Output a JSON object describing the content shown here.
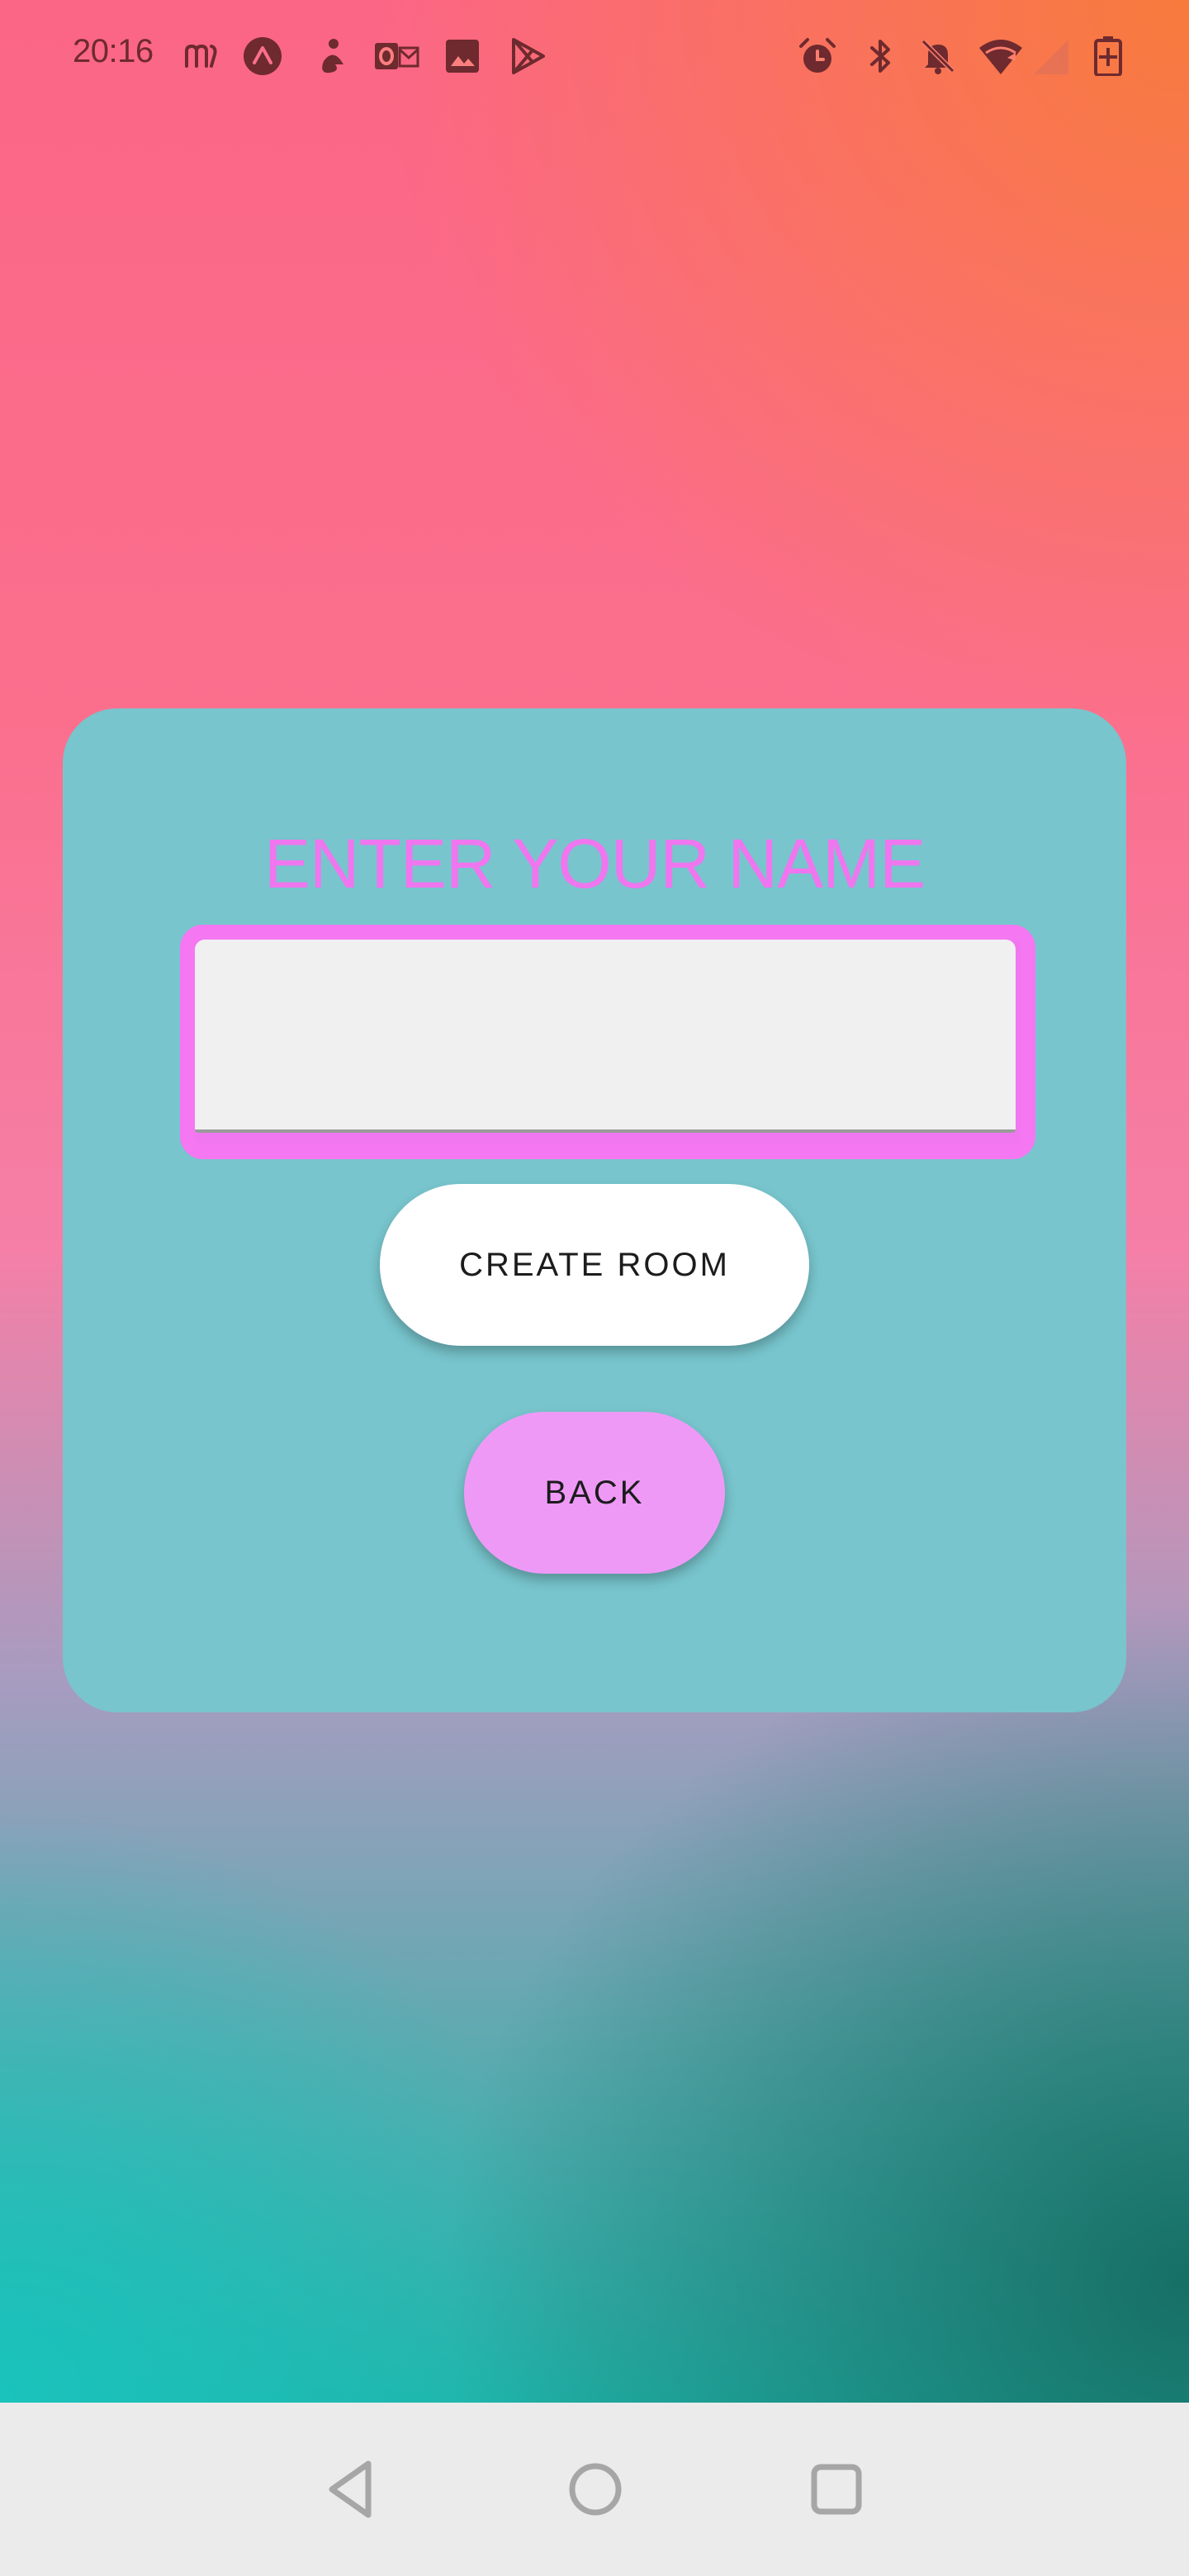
{
  "status_bar": {
    "time": "20:16",
    "left_icons": [
      "mi-fit-icon",
      "expo-icon",
      "mitra-icon",
      "outlook-icon",
      "gallery-icon",
      "play-store-icon"
    ],
    "right_icons": [
      "alarm-icon",
      "bluetooth-icon",
      "mute-icon",
      "wifi-icon",
      "signal-icon",
      "battery-charging-icon"
    ],
    "icon_color": "#6e2a2e"
  },
  "card": {
    "title": "ENTER YOUR NAME",
    "name_input": {
      "value": "",
      "placeholder": ""
    },
    "create_room_label": "CREATE ROOM",
    "back_label": "BACK"
  },
  "colors": {
    "card_bg": "#78c5cd",
    "title_color": "#ef76ef",
    "input_border": "#f577f2",
    "create_button_bg": "#ffffff",
    "back_button_bg": "#ef99f7",
    "nav_bar_bg": "#ebebeb"
  },
  "nav_bar": {
    "buttons": [
      "back-triangle-icon",
      "home-circle-icon",
      "recents-square-icon"
    ]
  }
}
